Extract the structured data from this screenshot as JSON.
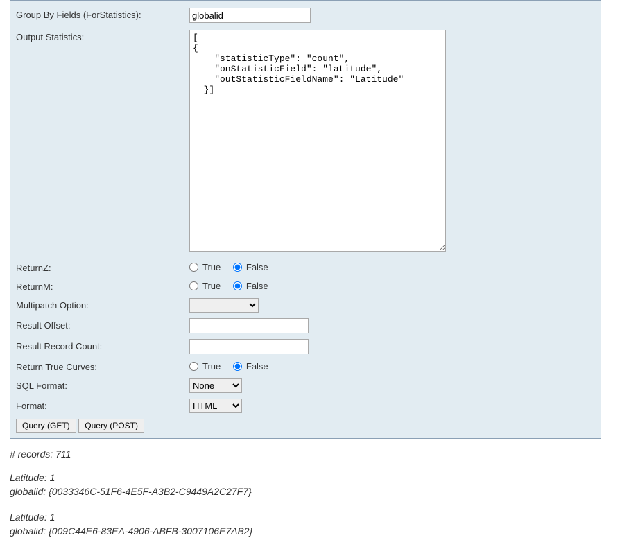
{
  "labels": {
    "group_by": "Group By Fields (ForStatistics):",
    "out_stats": "Output Statistics:",
    "return_z": "ReturnZ:",
    "return_m": "ReturnM:",
    "multipatch": "Multipatch Option:",
    "result_offset": "Result Offset:",
    "result_record_count": "Result Record Count:",
    "return_true_curves": "Return True Curves:",
    "sql_format": "SQL Format:",
    "format": "Format:"
  },
  "values": {
    "group_by": "globalid",
    "out_stats": "[\n{\n    \"statisticType\": \"count\",\n    \"onStatisticField\": \"latitude\",\n    \"outStatisticFieldName\": \"Latitude\"\n  }]",
    "result_offset": "",
    "result_record_count": ""
  },
  "radio": {
    "true_label": "True",
    "false_label": "False"
  },
  "selects": {
    "multipatch_selected": "",
    "sql_format_selected": "None",
    "format_selected": "HTML"
  },
  "buttons": {
    "query_get": "Query (GET)",
    "query_post": "Query (POST)"
  },
  "results": {
    "count_label": "# records: 711",
    "records": [
      {
        "lat_line": "Latitude: 1",
        "gid_line": "globalid: {0033346C-51F6-4E5F-A3B2-C9449A2C27F7}"
      },
      {
        "lat_line": "Latitude: 1",
        "gid_line": "globalid: {009C44E6-83EA-4906-ABFB-3007106E7AB2}"
      }
    ]
  }
}
